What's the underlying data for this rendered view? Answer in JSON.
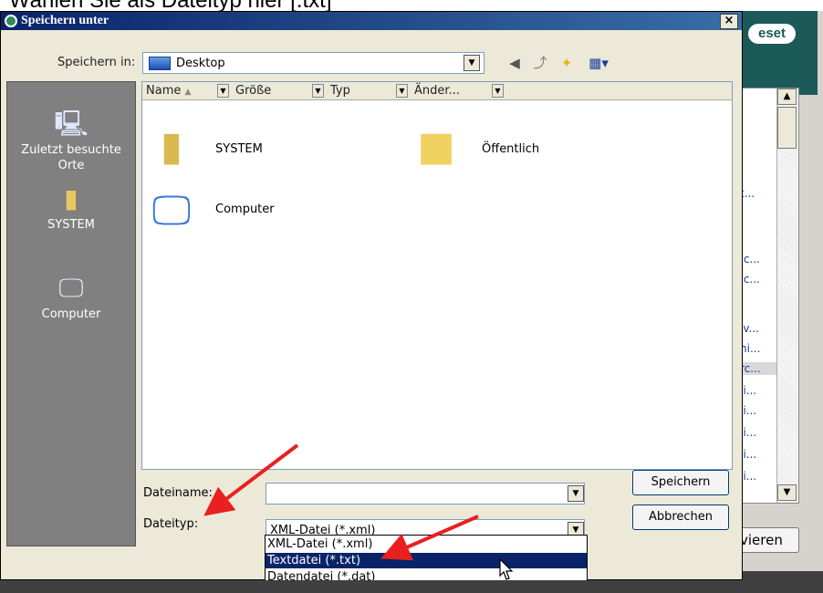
{
  "caption": "Wählen Sie als Dateityp hier [.txt]",
  "dialog": {
    "title": "Speichern unter",
    "close_label": "×",
    "save_in_label": "Speichern in:",
    "save_in_value": "Desktop",
    "toolbar_icons": [
      "back-icon",
      "up-folder-icon",
      "new-folder-icon",
      "view-menu-icon"
    ]
  },
  "places": [
    {
      "label": "Zuletzt besuchte Orte",
      "icon": "recent-places-icon"
    },
    {
      "label": "SYSTEM",
      "icon": "user-folder-icon"
    },
    {
      "label": "Computer",
      "icon": "computer-icon"
    }
  ],
  "columns": [
    "Name",
    "Größe",
    "Typ",
    "Änder..."
  ],
  "files": [
    {
      "name": "SYSTEM",
      "icon": "user-folder-icon"
    },
    {
      "name": "Öffentlich",
      "icon": "folder-icon"
    },
    {
      "name": "Computer",
      "icon": "computer-icon"
    }
  ],
  "filename": {
    "label": "Dateiname:",
    "value": ""
  },
  "filetype": {
    "label": "Dateityp:",
    "value": "XML-Datei (*.xml)",
    "options": [
      "XML-Datei (*.xml)",
      "Textdatei (*.txt)",
      "Datendatei (*.dat)"
    ],
    "highlighted": "Textdatei (*.txt)"
  },
  "buttons": {
    "save": "Speichern",
    "cancel": "Abbrechen"
  },
  "background_window": {
    "logo": "eset",
    "items": [
      "t...",
      ".c...",
      ".c...",
      "iv...",
      "ni...",
      "rc...",
      "li...",
      "li...",
      "li...",
      "li...",
      "li..."
    ],
    "button": "vieren"
  },
  "colors": {
    "title_bar": "#0a246a",
    "eset_header": "#1b5a58",
    "arrow": "#e82020",
    "selection": "#0a246a"
  }
}
